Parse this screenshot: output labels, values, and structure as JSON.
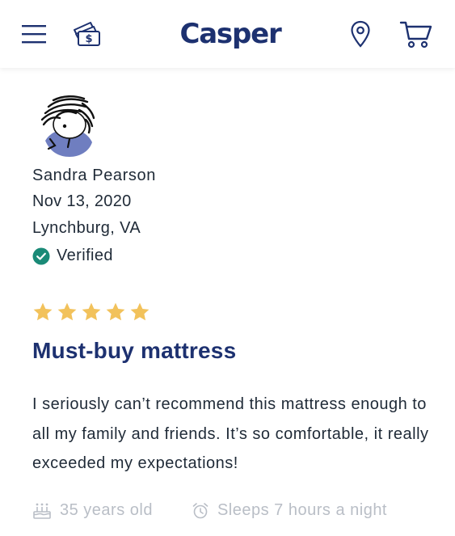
{
  "header": {
    "logo_text": "Casper",
    "icons": [
      "hamburger-menu-icon",
      "deals-money-icon",
      "location-pin-icon",
      "shopping-cart-icon"
    ],
    "brand_color": "#1d3170"
  },
  "review": {
    "reviewer_name": "Sandra Pearson",
    "date": "Nov 13, 2020",
    "location": "Lynchburg, VA",
    "verified_label": "Verified",
    "verified_color": "#1a8a77",
    "rating": 5,
    "rating_max": 5,
    "star_color": "#f2c25b",
    "title": "Must-buy mattress",
    "body": "I seriously can’t recommend this mattress enough to all my family and friends. It’s so comfortable, it really exceeded my expectations!",
    "age": "35 years old",
    "sleep": "Sleeps 7 hours a night"
  }
}
